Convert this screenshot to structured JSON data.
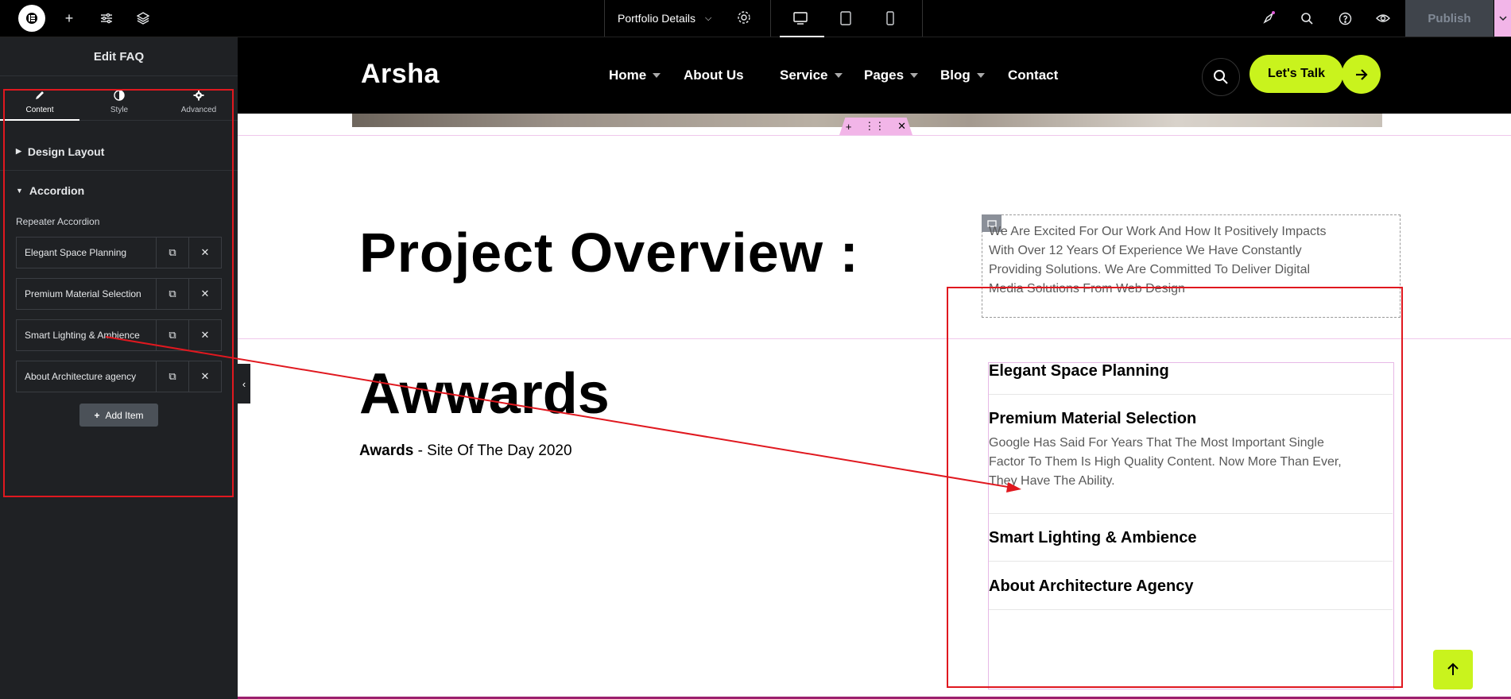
{
  "topbar": {
    "doc_title": "Portfolio Details",
    "publish_label": "Publish"
  },
  "panel": {
    "title": "Edit FAQ",
    "tabs": [
      {
        "label": "Content"
      },
      {
        "label": "Style"
      },
      {
        "label": "Advanced"
      }
    ],
    "sections": {
      "design_layout": "Design Layout",
      "accordion": "Accordion"
    },
    "repeater_label": "Repeater Accordion",
    "items": [
      {
        "label": "Elegant Space Planning"
      },
      {
        "label": "Premium Material Selection"
      },
      {
        "label": "Smart Lighting & Ambience"
      },
      {
        "label": "About Architecture agency"
      }
    ],
    "add_item_label": "Add Item"
  },
  "site": {
    "brand": "Arsha",
    "nav": [
      {
        "label": "Home"
      },
      {
        "label": "About Us"
      },
      {
        "label": "Service"
      },
      {
        "label": "Pages"
      },
      {
        "label": "Blog"
      },
      {
        "label": "Contact"
      }
    ],
    "cta_label": "Let's Talk",
    "accent_color": "#c9f31d"
  },
  "content": {
    "overview_heading": "Project Overview :",
    "intro_text": "We Are Excited For Our Work And How It Positively Impacts With Over 12 Years Of Experience We Have Constantly Providing Solutions. We Are Committed To Deliver Digital Media Solutions From Web Design",
    "awards_heading": "Awwards",
    "awards_label": "Awards",
    "awards_value": " - Site Of The Day 2020",
    "faq": [
      {
        "title": "Elegant Space Planning"
      },
      {
        "title": "Premium Material Selection",
        "body": "Google Has Said For Years That The Most Important Single Factor To Them Is High Quality Content. Now More Than Ever, They Have The Ability."
      },
      {
        "title": "Smart Lighting & Ambience"
      },
      {
        "title": "About Architecture Agency"
      }
    ]
  },
  "annotation_color": "#e0181f"
}
